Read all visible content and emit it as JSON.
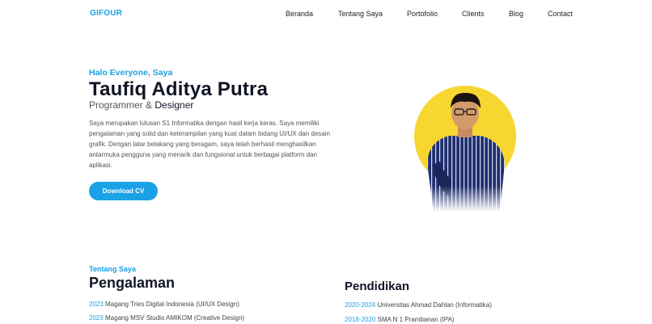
{
  "nav": {
    "logo": "GIFOUR",
    "items": [
      {
        "label": "Beranda"
      },
      {
        "label": "Tentang Saya"
      },
      {
        "label": "Portofolio"
      },
      {
        "label": "Clients"
      },
      {
        "label": "Blog"
      },
      {
        "label": "Contact"
      }
    ]
  },
  "hero": {
    "greeting": "Halo Everyone, Saya",
    "name": "Taufiq Aditya Putra",
    "role_part1": "Programmer & ",
    "role_part2": "Designer",
    "description": "Saya merupakan lulusan S1 Informatika dengan hasil kerja keras. Saya memiliki pengalaman yang solid dan keterampilan yang kuat dalam bidang UI/UX dan desain grafik. Dengan latar belakang yang beragam, saya telah berhasil menghasilkan antarmuka pengguna yang menarik dan fungsional untuk berbagai platform dan aplikasi.",
    "button": "Download CV"
  },
  "about": {
    "label": "Tentang Saya",
    "experience_title": "Pengalaman",
    "experience": [
      {
        "year": "2023",
        "text": " Magang Tries Digital Indonesia (UI/UX Design)"
      },
      {
        "year": "2023",
        "text": " Magang MSV Studio AMIKOM (Creative Design)"
      }
    ],
    "education_title": "Pendidikan",
    "education": [
      {
        "year": "2020-2024",
        "text": " Universitas Ahmad Dahlan (Informatika)"
      },
      {
        "year": "2018-2020",
        "text": " SMA N 1 Prambanan (IPA)"
      }
    ]
  },
  "colors": {
    "accent": "#1aa1e6",
    "circle": "#f7d631",
    "heading": "#111424"
  }
}
